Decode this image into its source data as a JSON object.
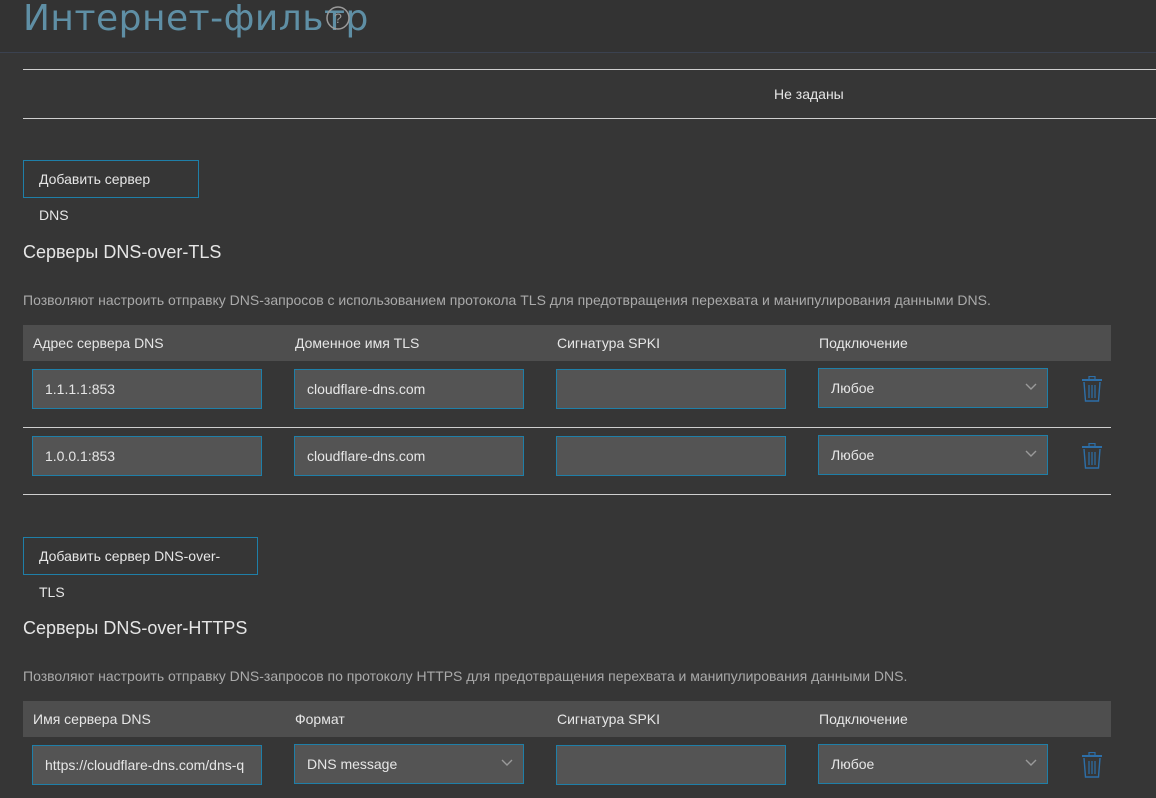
{
  "header": {
    "title": "Интернет-фильтр",
    "help_icon": "question-circle-icon"
  },
  "dns_servers": {
    "empty_text": "Не заданы",
    "add_button_label": "Добавить сервер DNS"
  },
  "dot": {
    "title": "Серверы DNS-over-TLS",
    "description": "Позволяют настроить отправку DNS-запросов с использованием протокола TLS для предотвращения перехвата и манипулирования данными DNS.",
    "columns": [
      "Адрес сервера DNS",
      "Доменное имя TLS",
      "Сигнатура SPKI",
      "Подключение"
    ],
    "rows": [
      {
        "address": "1.1.1.1:853",
        "tls_name": "cloudflare-dns.com",
        "spki": "",
        "connection": "Любое"
      },
      {
        "address": "1.0.0.1:853",
        "tls_name": "cloudflare-dns.com",
        "spki": "",
        "connection": "Любое"
      }
    ],
    "add_button_label": "Добавить сервер DNS-over-TLS"
  },
  "doh": {
    "title": "Серверы DNS-over-HTTPS",
    "description": "Позволяют настроить отправку DNS-запросов по протоколу HTTPS для предотвращения перехвата и манипулирования данными DNS.",
    "columns": [
      "Имя сервера DNS",
      "Формат",
      "Сигнатура SPKI",
      "Подключение"
    ],
    "rows": [
      {
        "name": "https://cloudflare-dns.com/dns-q",
        "format": "DNS message",
        "spki": "",
        "connection": "Любое"
      }
    ]
  },
  "colors": {
    "background": "#363636",
    "accent_border": "#1f7fa8",
    "title_color": "#5f8fa5",
    "trash_icon": "#2d6fa8"
  }
}
